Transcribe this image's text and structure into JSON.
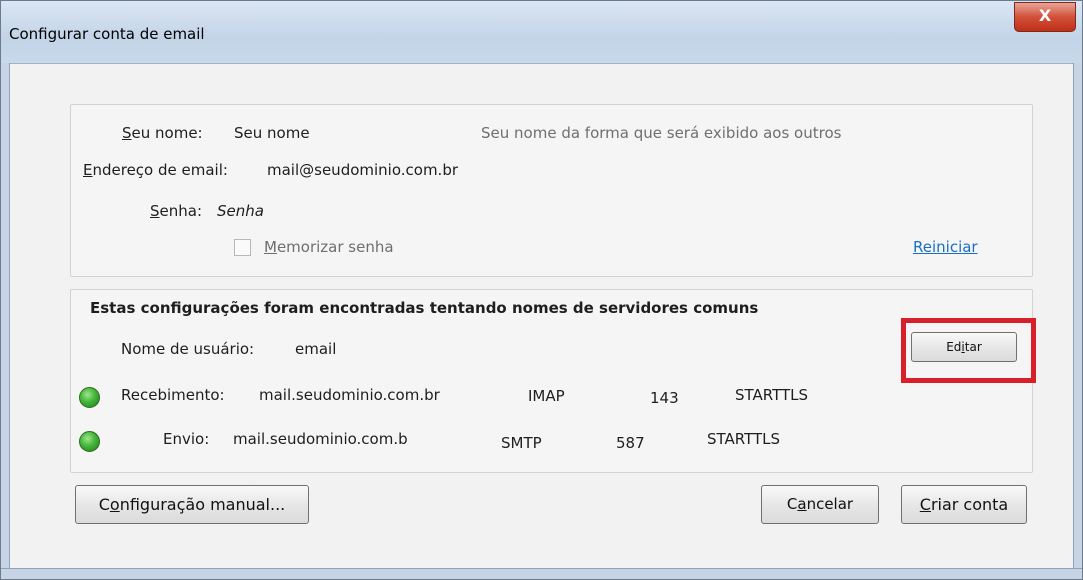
{
  "window": {
    "title": "Configurar conta de email",
    "close_label": "X"
  },
  "account": {
    "name_label_u": "S",
    "name_label_rest": "eu nome:",
    "name_value": "Seu nome",
    "name_hint": "Seu nome da forma que será exibido aos outros",
    "email_label_u": "E",
    "email_label_rest": "ndereço de email:",
    "email_value": "mail@seudominio.com.br",
    "password_label_u": "S",
    "password_label_rest": "enha:",
    "password_value": "Senha",
    "remember_u": "M",
    "remember_rest": "emorizar senha",
    "remember_checked": false,
    "reset_link": "Reiniciar"
  },
  "servers": {
    "heading": "Estas configurações foram encontradas tentando nomes de servidores comuns",
    "username_label": "Nome de usuário:",
    "username_value": "email",
    "edit_button_pre": "Ed",
    "edit_button_u": "i",
    "edit_button_post": "tar",
    "incoming": {
      "label": "Recebimento:",
      "host": "mail.seudominio.com.br",
      "protocol": "IMAP",
      "port": "143",
      "security": "STARTTLS"
    },
    "outgoing": {
      "label": "Envio:",
      "host": "mail.seudominio.com.b",
      "protocol": "SMTP",
      "port": "587",
      "security": "STARTTLS"
    }
  },
  "actions": {
    "manual_pre": "C",
    "manual_u": "o",
    "manual_post": "nfiguração manual...",
    "cancel_pre": "C",
    "cancel_u": "a",
    "cancel_post": "ncelar",
    "create_u": "C",
    "create_post": "riar conta"
  },
  "colors": {
    "highlight": "#d8202a",
    "status_ok": "#44b53a",
    "link": "#1a6fc4"
  }
}
